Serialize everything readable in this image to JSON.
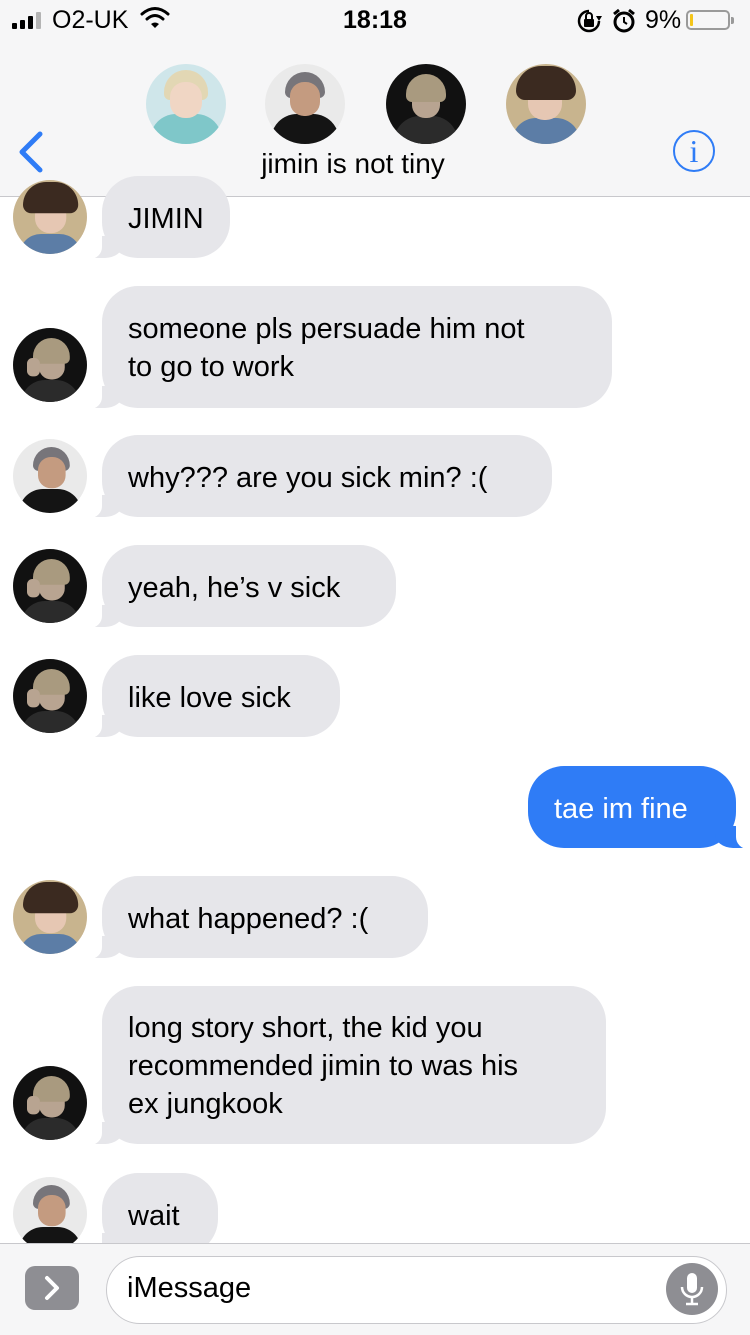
{
  "status_bar": {
    "carrier": "O2-UK",
    "time": "18:18",
    "battery_percent": "9%",
    "battery_level": 0.09,
    "icons": [
      "signal-icon",
      "wifi-icon",
      "rotation-lock-icon",
      "alarm-icon",
      "battery-icon"
    ]
  },
  "header": {
    "group_name": "jimin is not tiny",
    "participants": [
      "jimin-avatar",
      "namjoon-avatar",
      "taehyung-avatar",
      "hoseok-avatar"
    ],
    "back_icon": "chevron-left-icon",
    "info_icon": "info-icon"
  },
  "messages": [
    {
      "direction": "in",
      "avatar": "hoseok",
      "lines": [
        "JIMIN"
      ]
    },
    {
      "direction": "in",
      "avatar": "taehyung",
      "lines": [
        "someone pls persuade him not",
        "to go to work"
      ]
    },
    {
      "direction": "in",
      "avatar": "namjoon",
      "lines": [
        "why??? are you sick min? :("
      ]
    },
    {
      "direction": "in",
      "avatar": "taehyung",
      "lines": [
        "yeah, he’s v sick"
      ]
    },
    {
      "direction": "in",
      "avatar": "taehyung",
      "lines": [
        "like love sick"
      ]
    },
    {
      "direction": "out",
      "lines": [
        "tae im fine"
      ]
    },
    {
      "direction": "in",
      "avatar": "hoseok",
      "lines": [
        "what happened? :("
      ]
    },
    {
      "direction": "in",
      "avatar": "taehyung",
      "lines": [
        "long story short, the kid you",
        "recommended jimin to was his",
        "ex jungkook"
      ]
    },
    {
      "direction": "in",
      "avatar": "namjoon",
      "lines": [
        "wait"
      ]
    }
  ],
  "compose": {
    "placeholder": "iMessage",
    "apps_icon": "chevron-right-icon",
    "mic_icon": "microphone-icon"
  },
  "colors": {
    "accent_blue": "#2f7cf6",
    "incoming_bubble": "#e6e6ea",
    "header_bg": "#f6f6f7",
    "battery_low": "#f4c51a"
  }
}
